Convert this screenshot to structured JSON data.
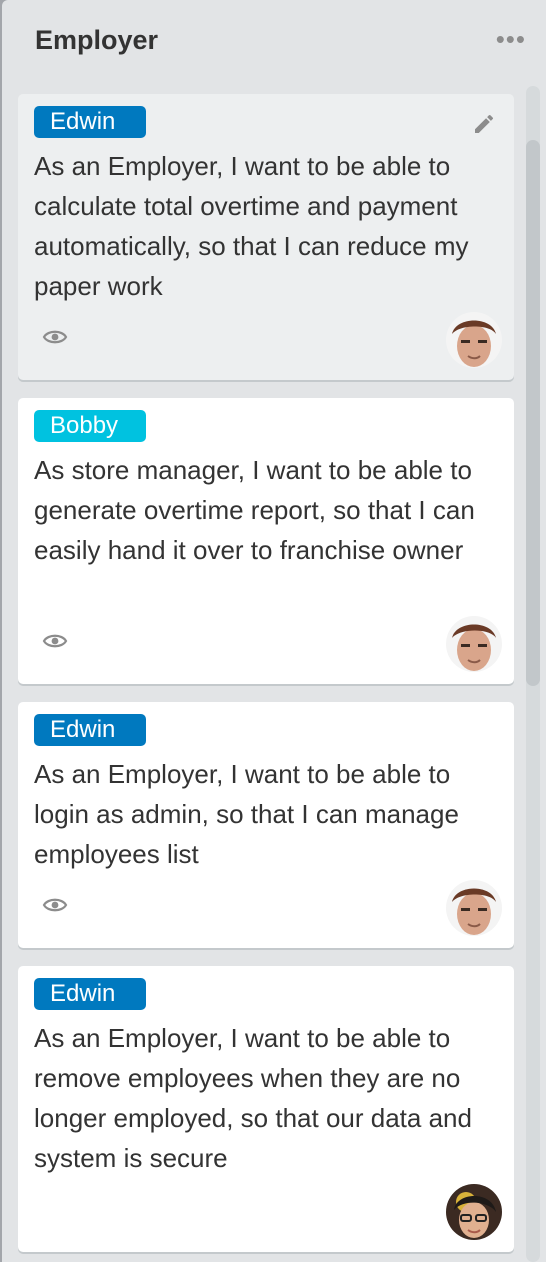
{
  "list": {
    "title": "Employer",
    "menu_glyph": "•••"
  },
  "colors": {
    "label_blue": "#0079bf",
    "label_sky": "#00c2e0"
  },
  "cards": [
    {
      "label": "Edwin",
      "label_color": "#0079bf",
      "text": "As an Employer, I want to be able to calculate total overtime and payment automatically, so that I can reduce my paper work",
      "has_watch_icon": true,
      "edit_icon": "pencil-icon"
    },
    {
      "label": "Bobby",
      "label_color": "#00c2e0",
      "text": "As store manager, I want to be able to generate overtime report, so that I can easily hand it over to franchise owner",
      "has_watch_icon": true
    },
    {
      "label": "Edwin",
      "label_color": "#0079bf",
      "text": "As an Employer, I want to be able to login as admin, so that I can manage employees list",
      "has_watch_icon": true
    },
    {
      "label": "Edwin",
      "label_color": "#0079bf",
      "text": "As an Employer, I want to be able to remove employees when they are no longer employed, so that our data and system is secure",
      "has_watch_icon": false
    }
  ]
}
